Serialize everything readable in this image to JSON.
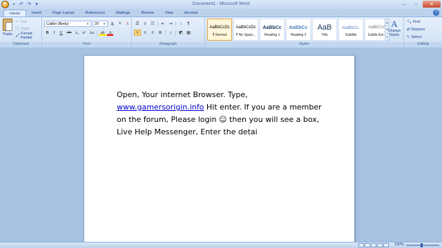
{
  "title_bar": {
    "title": "Document1 - Microsoft Word",
    "qat": [
      "save-icon",
      "undo-icon",
      "redo-icon",
      "customize-icon"
    ]
  },
  "tabs": [
    "Home",
    "Insert",
    "Page Layout",
    "References",
    "Mailings",
    "Review",
    "View",
    "Acrobat"
  ],
  "active_tab": "Home",
  "clipboard": {
    "paste_label": "Paste",
    "cut_label": "Cut",
    "copy_label": "Copy",
    "format_painter_label": "Format Painter",
    "group_label": "Clipboard"
  },
  "font": {
    "font_name": "Calibri (Body)",
    "font_size": "20",
    "bold": "B",
    "italic": "I",
    "underline": "U",
    "strike": "abe",
    "subscript": "x₂",
    "superscript": "x²",
    "change_case": "Aa",
    "grow": "A",
    "shrink": "A",
    "clear": "A",
    "highlight": "ab",
    "font_color": "A",
    "group_label": "Font"
  },
  "paragraph": {
    "group_label": "Paragraph"
  },
  "styles": {
    "items": [
      {
        "sample": "AaBbCcDc",
        "name": "¶ Normal"
      },
      {
        "sample": "AaBbCcDc",
        "name": "¶ No Spaci..."
      },
      {
        "sample": "AaBbCc",
        "name": "Heading 1"
      },
      {
        "sample": "AaBbCc",
        "name": "Heading 2"
      },
      {
        "sample": "AaB",
        "name": "Title"
      },
      {
        "sample": "AaBbCc.",
        "name": "Subtitle"
      },
      {
        "sample": "AaBbCcD",
        "name": "Subtle Em..."
      }
    ],
    "selected_index": 0,
    "change_styles_label_1": "Change",
    "change_styles_label_2": "Styles",
    "group_label": "Styles"
  },
  "editing": {
    "find_label": "Find",
    "replace_label": "Replace",
    "select_label": "Select",
    "group_label": "Editing"
  },
  "document": {
    "line1": "Open, Your internet Browser. Type,",
    "link": "www.gamersorigin.info",
    "line2_rest": " Hit enter. If you are a member",
    "line3": "on the forum, Please login ☺ then you will see a box,",
    "line4": "Live Help Messenger, Enter the detai"
  },
  "status_bar": {
    "zoom": "100%"
  },
  "colors": {
    "accent": "#15428b",
    "ribbon_bg": "#dbe8f9",
    "link": "#0000cc"
  }
}
